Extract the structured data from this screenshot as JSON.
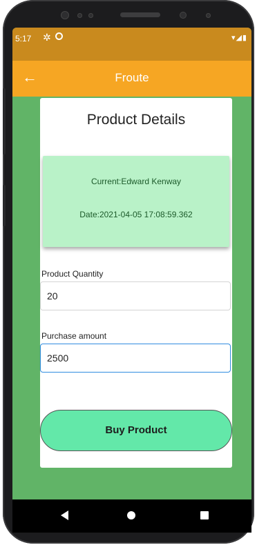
{
  "status_bar": {
    "time": "5:17",
    "settings_icon": "gear-icon",
    "dnd_icon": "do-not-disturb-icon",
    "signal_icons": "▾◢▮"
  },
  "app_bar": {
    "back_icon": "←",
    "title": "Froute",
    "color": "#f6a623"
  },
  "card": {
    "heading": "Product Details",
    "info": {
      "current_user": "Current:Edward Kenway",
      "date": "Date:2021-04-05 17:08:59.362"
    },
    "quantity": {
      "label": "Product Quantity",
      "value": "20"
    },
    "amount": {
      "label": "Purchase amount",
      "value": "2500"
    },
    "buy_button_label": "Buy Product"
  },
  "colors": {
    "background": "#61b467",
    "info_box": "#b9f2c8",
    "button": "#63e8a9",
    "focus": "#2f8be0"
  }
}
